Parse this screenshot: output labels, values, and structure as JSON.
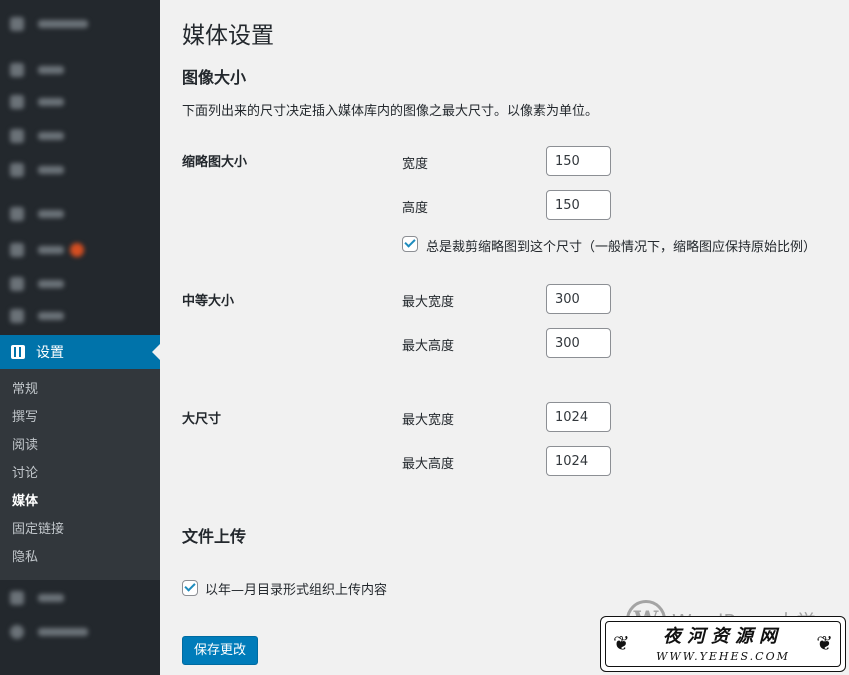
{
  "sidebar": {
    "current_label": "设置",
    "submenu": [
      "常规",
      "撰写",
      "阅读",
      "讨论",
      "媒体",
      "固定链接",
      "隐私"
    ],
    "current_submenu": "媒体"
  },
  "page": {
    "title": "媒体设置",
    "image_sizes": {
      "title": "图像大小",
      "description": "下面列出来的尺寸决定插入媒体库内的图像之最大尺寸。以像素为单位。",
      "thumbnail": {
        "label": "缩略图大小",
        "width_label": "宽度",
        "width": "150",
        "height_label": "高度",
        "height": "150",
        "crop_label": "总是裁剪缩略图到这个尺寸（一般情况下，缩略图应保持原始比例）",
        "crop_checked": true
      },
      "medium": {
        "label": "中等大小",
        "width_label": "最大宽度",
        "width": "300",
        "height_label": "最大高度",
        "height": "300"
      },
      "large": {
        "label": "大尺寸",
        "width_label": "最大宽度",
        "width": "1024",
        "height_label": "最大高度",
        "height": "1024"
      }
    },
    "uploads": {
      "title": "文件上传",
      "organize_label": "以年—月目录形式组织上传内容",
      "organize_checked": true
    },
    "save_label": "保存更改"
  },
  "watermark": {
    "brand": "WordPress大学",
    "stamp_title": "夜河资源网",
    "stamp_url": "WWW.YEHES.COM"
  },
  "colors": {
    "sidebar_bg": "#23282d",
    "accent": "#0073aa",
    "button": "#007cba"
  }
}
